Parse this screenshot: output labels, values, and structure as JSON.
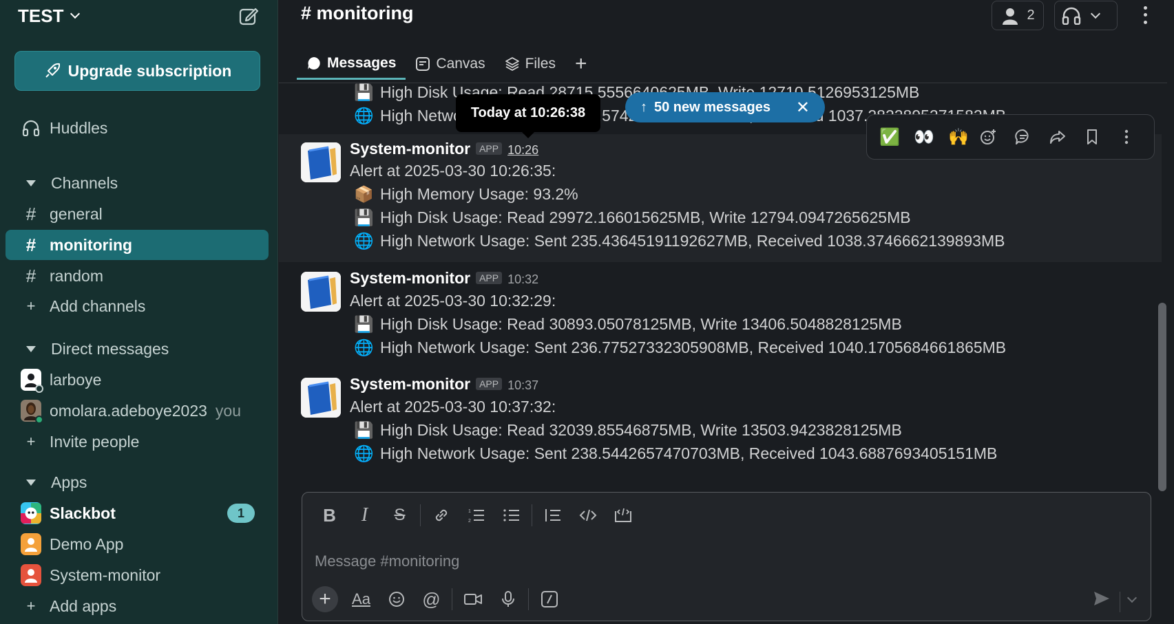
{
  "workspace": {
    "name": "TEST"
  },
  "sidebar": {
    "upgrade_label": "Upgrade subscription",
    "huddles_label": "Huddles",
    "channels_header": "Channels",
    "channels": [
      {
        "name": "general",
        "active": false
      },
      {
        "name": "monitoring",
        "active": true
      },
      {
        "name": "random",
        "active": false
      }
    ],
    "add_channels_label": "Add channels",
    "dm_header": "Direct messages",
    "dms": [
      {
        "name": "larboye"
      },
      {
        "name": "omolara.adeboye2023",
        "suffix": "you"
      }
    ],
    "invite_label": "Invite people",
    "apps_header": "Apps",
    "apps": [
      {
        "name": "Slackbot",
        "badge": "1",
        "bold": true
      },
      {
        "name": "Demo App"
      },
      {
        "name": "System-monitor"
      }
    ],
    "add_apps_label": "Add apps"
  },
  "channel": {
    "title": "# monitoring",
    "member_count": "2"
  },
  "tabs": [
    {
      "label": "Messages",
      "active": true
    },
    {
      "label": "Canvas"
    },
    {
      "label": "Files"
    }
  ],
  "messages": [
    {
      "partial": true,
      "lines": [
        "High Disk Usage: Read 28715.5556640625MB, Write 12710.5126953125MB",
        "High Network Usage: Sent 234.57427062988281MB, Received 1037.2822895271582MB"
      ]
    },
    {
      "sender": "System-monitor",
      "app_tag": "APP",
      "time": "10:26",
      "lines": [
        "Alert at 2025-03-30 10:26:35:",
        "High Memory Usage: 93.2%",
        "High Disk Usage: Read 29972.166015625MB, Write 12794.0947265625MB",
        "High Network Usage: Sent 235.43645191192627MB, Received 1038.3746662139893MB"
      ]
    },
    {
      "sender": "System-monitor",
      "app_tag": "APP",
      "time": "10:32",
      "lines": [
        "Alert at 2025-03-30 10:32:29:",
        "High Disk Usage: Read 30893.05078125MB, Write 13406.5048828125MB",
        "High Network Usage: Sent 236.77527332305908MB, Received 1040.1705684661865MB"
      ]
    },
    {
      "sender": "System-monitor",
      "app_tag": "APP",
      "time": "10:37",
      "lines": [
        "Alert at 2025-03-30 10:37:32:",
        "High Disk Usage: Read 32039.85546875MB, Write 13503.9423828125MB",
        "High Network Usage: Sent 238.5442657470703MB, Received 1043.6887693405151MB"
      ]
    }
  ],
  "emojis": {
    "disk": "💾",
    "network": "🌐",
    "memory": "📦"
  },
  "new_messages_pill": "50 new messages",
  "tooltip": "Today at 10:26:38",
  "quick_reactions": [
    "✅",
    "👀",
    "🙌"
  ],
  "composer": {
    "placeholder": "Message #monitoring"
  },
  "colors": {
    "sidebar_bg": "#16302f",
    "active_channel": "#1c6c73",
    "accent": "#1d6fa5",
    "badge": "#6fc5c8"
  }
}
